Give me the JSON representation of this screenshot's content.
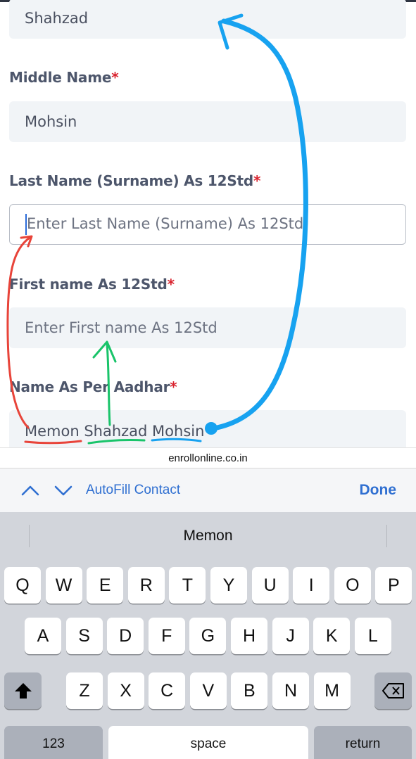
{
  "form": {
    "first_value": "Shahzad",
    "middle_label": "Middle Name",
    "middle_value": "Mohsin",
    "last_label": "Last Name (Surname) As 12Std",
    "last_placeholder": "Enter Last Name (Surname) As 12Std",
    "first12_label": "First name As 12Std",
    "first12_placeholder": "Enter First name As 12Std",
    "aadhar_label": "Name As Per Aadhar",
    "aadhar_value": "Memon Shahzad Mohsin",
    "required_mark": "*"
  },
  "accessory": {
    "site": "enrollonline.co.in",
    "autofill": "AutoFill Contact",
    "done": "Done"
  },
  "keyboard": {
    "suggestion": "Memon",
    "row1": [
      "Q",
      "W",
      "E",
      "R",
      "T",
      "Y",
      "U",
      "I",
      "O",
      "P"
    ],
    "row2": [
      "A",
      "S",
      "D",
      "F",
      "G",
      "H",
      "J",
      "K",
      "L"
    ],
    "row3": [
      "Z",
      "X",
      "C",
      "V",
      "B",
      "N",
      "M"
    ],
    "numbers": "123",
    "space": "space",
    "return": "return"
  },
  "annotation_colors": {
    "red": "#e8443a",
    "green": "#19c46a",
    "blue": "#17a2f0"
  },
  "icons": [
    "chevron-up-icon",
    "chevron-down-icon",
    "shift-icon",
    "backspace-icon"
  ]
}
